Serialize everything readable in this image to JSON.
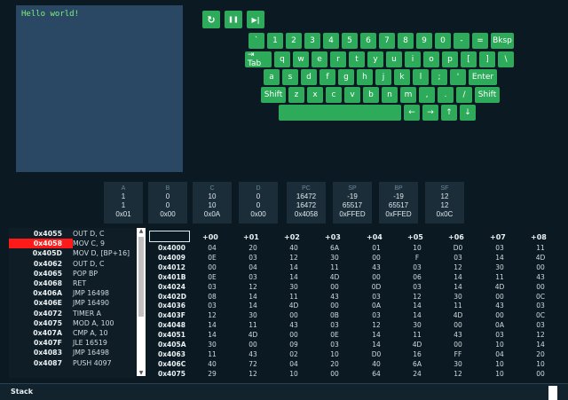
{
  "terminal": {
    "output": "Hello world!"
  },
  "controls": {
    "reset_icon": "↻",
    "pause_icon": "❚❚",
    "step_icon": "▶|"
  },
  "keyboard": {
    "rows": [
      [
        "`",
        "1",
        "2",
        "3",
        "4",
        "5",
        "6",
        "7",
        "8",
        "9",
        "0",
        "-",
        "=",
        "Bksp"
      ],
      [
        "⇥ Tab",
        "q",
        "w",
        "e",
        "r",
        "t",
        "y",
        "u",
        "i",
        "o",
        "p",
        "[",
        "]",
        "\\"
      ],
      [
        "a",
        "s",
        "d",
        "f",
        "g",
        "h",
        "j",
        "k",
        "l",
        ";",
        "'",
        "Enter"
      ],
      [
        "Shift",
        "z",
        "x",
        "c",
        "v",
        "b",
        "n",
        "m",
        ",",
        ".",
        "/",
        "Shift"
      ],
      [
        "",
        "←",
        "→",
        "↑",
        "↓"
      ]
    ]
  },
  "registers": [
    {
      "name": "A",
      "values": [
        "1",
        "1",
        "0x01"
      ]
    },
    {
      "name": "B",
      "values": [
        "0",
        "0",
        "0x00"
      ]
    },
    {
      "name": "C",
      "values": [
        "10",
        "10",
        "0x0A"
      ]
    },
    {
      "name": "D",
      "values": [
        "0",
        "0",
        "0x00"
      ]
    },
    {
      "name": "PC",
      "values": [
        "16472",
        "16472",
        "0x4058"
      ]
    },
    {
      "name": "SP",
      "values": [
        "-19",
        "65517",
        "0xFFED"
      ]
    },
    {
      "name": "BP",
      "values": [
        "-19",
        "65517",
        "0xFFED"
      ]
    },
    {
      "name": "SF",
      "values": [
        "12",
        "12",
        "0x0C"
      ]
    }
  ],
  "code": {
    "active_index": 1,
    "rows": [
      {
        "addr": "0x4055",
        "ins": "OUT D, C"
      },
      {
        "addr": "0x4058",
        "ins": "MOV C, 9"
      },
      {
        "addr": "0x405D",
        "ins": "MOV D, [BP+16]"
      },
      {
        "addr": "0x4062",
        "ins": "OUT D, C"
      },
      {
        "addr": "0x4065",
        "ins": "POP BP"
      },
      {
        "addr": "0x4068",
        "ins": "RET"
      },
      {
        "addr": "0x406A",
        "ins": "JMP 16498"
      },
      {
        "addr": "0x406E",
        "ins": "JMP 16490"
      },
      {
        "addr": "0x4072",
        "ins": "TIMER A"
      },
      {
        "addr": "0x4075",
        "ins": "MOD A, 100"
      },
      {
        "addr": "0x407A",
        "ins": "CMP A, 10"
      },
      {
        "addr": "0x407F",
        "ins": "JLE 16519"
      },
      {
        "addr": "0x4083",
        "ins": "JMP 16498"
      },
      {
        "addr": "0x4087",
        "ins": "PUSH 4097"
      }
    ]
  },
  "memory": {
    "search_value": "",
    "columns": [
      "+00",
      "+01",
      "+02",
      "+03",
      "+04",
      "+05",
      "+06",
      "+07",
      "+08"
    ],
    "rows": [
      {
        "addr": "0x4000",
        "cells": [
          "04",
          "20",
          "40",
          "6A",
          "01",
          "10",
          "D0",
          "03",
          "11"
        ]
      },
      {
        "addr": "0x4009",
        "cells": [
          "0E",
          "03",
          "12",
          "30",
          "00",
          "F",
          "03",
          "14",
          "4D"
        ]
      },
      {
        "addr": "0x4012",
        "cells": [
          "00",
          "04",
          "14",
          "11",
          "43",
          "03",
          "12",
          "30",
          "00"
        ]
      },
      {
        "addr": "0x401B",
        "cells": [
          "0E",
          "03",
          "14",
          "4D",
          "00",
          "06",
          "14",
          "11",
          "43"
        ]
      },
      {
        "addr": "0x4024",
        "cells": [
          "03",
          "12",
          "30",
          "00",
          "0D",
          "03",
          "14",
          "4D",
          "00"
        ]
      },
      {
        "addr": "0x402D",
        "cells": [
          "08",
          "14",
          "11",
          "43",
          "03",
          "12",
          "30",
          "00",
          "0C"
        ]
      },
      {
        "addr": "0x4036",
        "cells": [
          "03",
          "14",
          "4D",
          "00",
          "0A",
          "14",
          "11",
          "43",
          "03"
        ]
      },
      {
        "addr": "0x403F",
        "cells": [
          "12",
          "30",
          "00",
          "0B",
          "03",
          "14",
          "4D",
          "00",
          "0C"
        ]
      },
      {
        "addr": "0x4048",
        "cells": [
          "14",
          "11",
          "43",
          "03",
          "12",
          "30",
          "00",
          "0A",
          "03"
        ]
      },
      {
        "addr": "0x4051",
        "cells": [
          "14",
          "4D",
          "00",
          "0E",
          "14",
          "11",
          "43",
          "03",
          "12"
        ]
      },
      {
        "addr": "0x405A",
        "cells": [
          "30",
          "00",
          "09",
          "03",
          "14",
          "4D",
          "00",
          "10",
          "14"
        ]
      },
      {
        "addr": "0x4063",
        "cells": [
          "11",
          "43",
          "02",
          "10",
          "D0",
          "16",
          "FF",
          "04",
          "20"
        ]
      },
      {
        "addr": "0x406C",
        "cells": [
          "40",
          "72",
          "04",
          "20",
          "40",
          "6A",
          "30",
          "10",
          "10"
        ]
      },
      {
        "addr": "0x4075",
        "cells": [
          "29",
          "12",
          "10",
          "00",
          "64",
          "24",
          "12",
          "10",
          "00"
        ]
      }
    ]
  },
  "stack": {
    "title": "Stack"
  },
  "colors": {
    "background": "#0b1a22",
    "terminal": "#2a4763",
    "key": "#2daa5a",
    "active_row": "#ff1a1a"
  }
}
